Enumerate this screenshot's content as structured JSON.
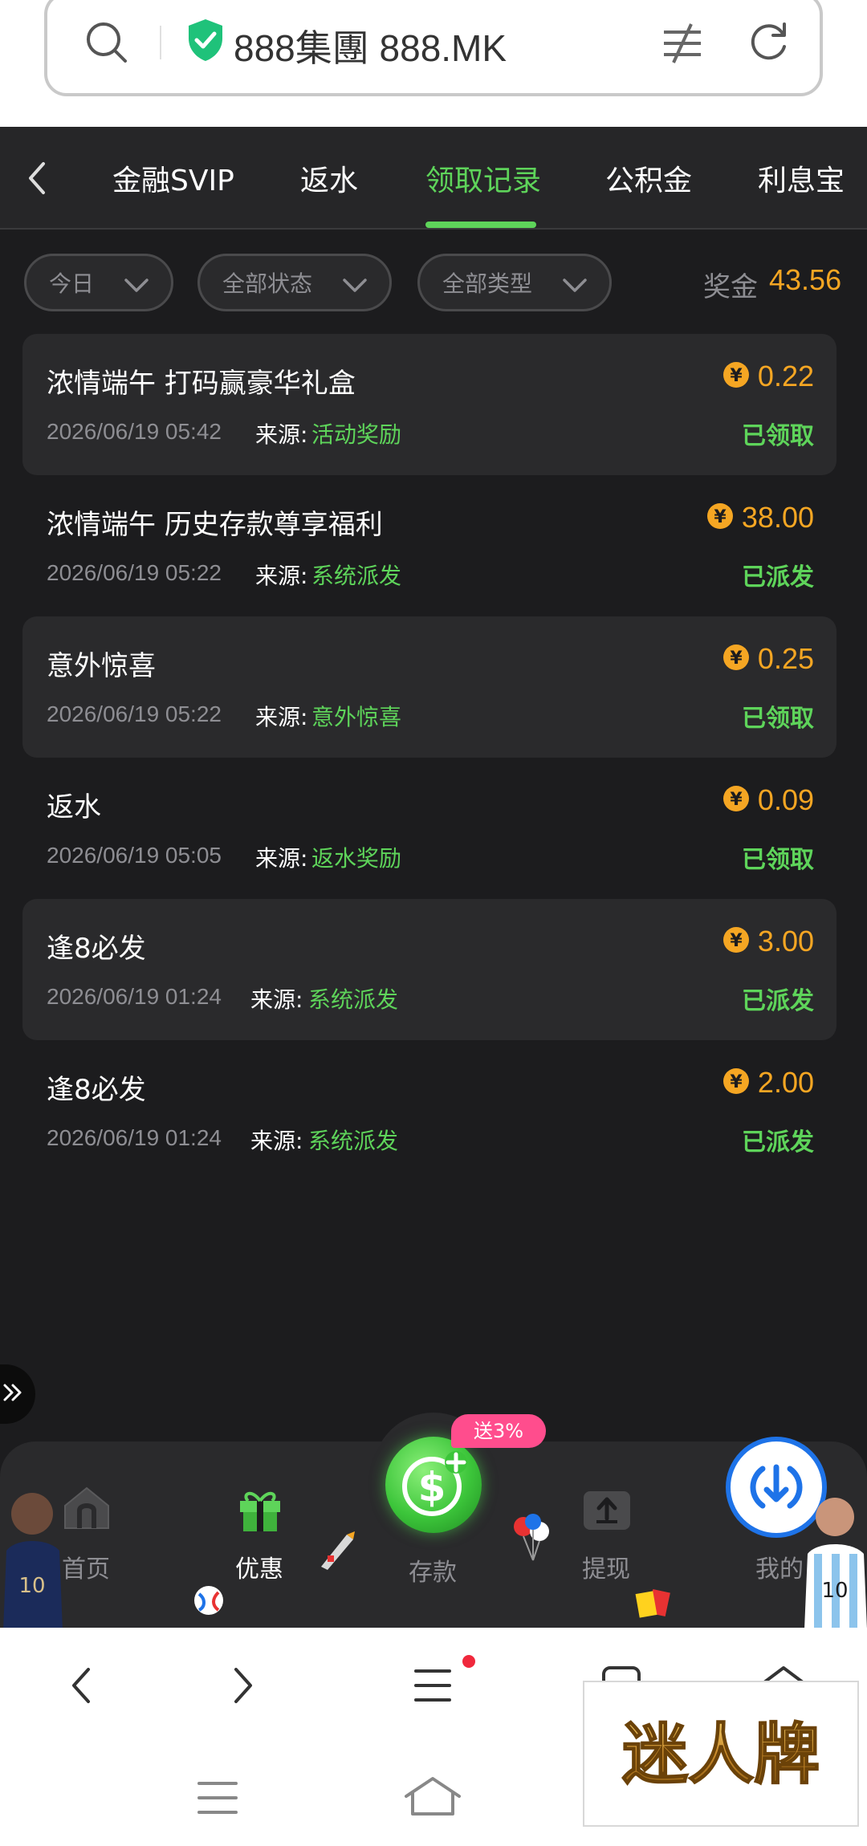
{
  "browser": {
    "url": "888集團 888.MK"
  },
  "tabs": [
    {
      "label": "金融SVIP"
    },
    {
      "label": "返水"
    },
    {
      "label": "领取记录"
    },
    {
      "label": "公积金"
    },
    {
      "label": "利息宝"
    }
  ],
  "filters": {
    "date": "今日",
    "status": "全部状态",
    "type": "全部类型",
    "bonus_label": "奖金",
    "bonus_value": "43.56"
  },
  "records": [
    {
      "title": "浓情端午 打码赢豪华礼盒",
      "date": "2026/06/19 05:42",
      "source_label": "来源:",
      "source": "活动奖励",
      "amount": "0.22",
      "status": "已领取"
    },
    {
      "title": "浓情端午 历史存款尊享福利",
      "date": "2026/06/19 05:22",
      "source_label": "来源:",
      "source": "系统派发",
      "amount": "38.00",
      "status": "已派发"
    },
    {
      "title": "意外惊喜",
      "date": "2026/06/19 05:22",
      "source_label": "来源:",
      "source": "意外惊喜",
      "amount": "0.25",
      "status": "已领取"
    },
    {
      "title": "返水",
      "date": "2026/06/19 05:05",
      "source_label": "来源:",
      "source": "返水奖励",
      "amount": "0.09",
      "status": "已领取"
    },
    {
      "title": "逢8必发",
      "date": "2026/06/19 01:24",
      "source_label": "来源:",
      "source": "系统派发",
      "amount": "3.00",
      "status": "已派发"
    },
    {
      "title": "逢8必发",
      "date": "2026/06/19 01:24",
      "source_label": "来源:",
      "source": "系统派发",
      "amount": "2.00",
      "status": "已派发"
    }
  ],
  "nav": {
    "home": "首页",
    "promo": "优惠",
    "deposit": "存款",
    "deposit_tag": "送3%",
    "withdraw": "提现",
    "mine": "我的"
  },
  "watermark": "迷人牌",
  "colors": {
    "accent_green": "#5ed45a",
    "amount_orange": "#f5a623",
    "background": "#1c1c1e",
    "promo_pink": "#ff4d8d"
  }
}
